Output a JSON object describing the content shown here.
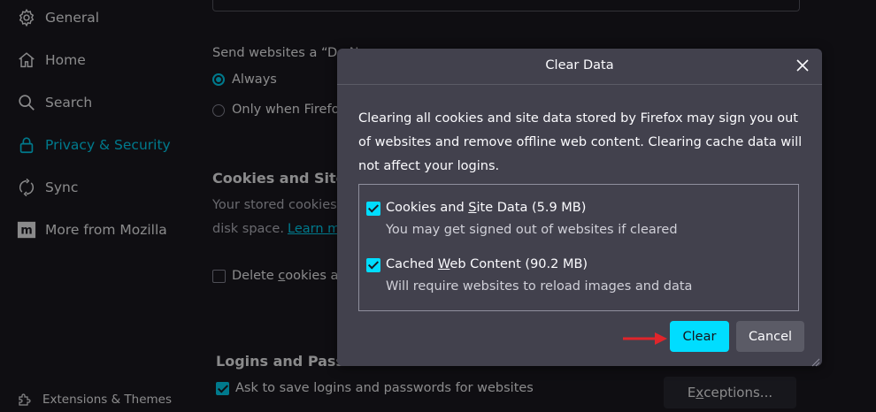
{
  "sidebar": {
    "items": [
      {
        "label": "General",
        "icon": "gear-icon"
      },
      {
        "label": "Home",
        "icon": "home-icon"
      },
      {
        "label": "Search",
        "icon": "search-icon"
      },
      {
        "label": "Privacy & Security",
        "icon": "lock-icon",
        "active": true
      },
      {
        "label": "Sync",
        "icon": "sync-icon"
      },
      {
        "label": "More from Mozilla",
        "icon": "mozilla-icon"
      }
    ],
    "extensions_label": "Extensions & Themes"
  },
  "main": {
    "dnt_text": "Send websites a “Do N",
    "radio_always": "Always",
    "radio_only_when": "Only when Firefox",
    "cookies_heading": "Cookies and Site D",
    "cookies_desc": "Your stored cookies, s",
    "disk_space": "disk space.",
    "learn_more": "Learn mo",
    "delete_cookies_pre": "Delete ",
    "delete_cookies_key": "c",
    "delete_cookies_post": "ookies and",
    "logins_heading": "Logins and Passw",
    "ask_save_logins": "Ask to save logins and passwords for websites",
    "exceptions_key": "x",
    "exceptions_pre": "E",
    "exceptions_post": "ceptions..."
  },
  "dialog": {
    "title": "Clear Data",
    "description": "Clearing all cookies and site data stored by Firefox may sign you out of websites and remove offline web content. Clearing cache data will not affect your logins.",
    "options": [
      {
        "label_pre": "Cookies and ",
        "label_key": "S",
        "label_post": "ite Data (5.9 MB)",
        "sub": "You may get signed out of websites if cleared",
        "checked": true
      },
      {
        "label_pre": "Cached ",
        "label_key": "W",
        "label_post": "eb Content (90.2 MB)",
        "sub": "Will require websites to reload images and data",
        "checked": true
      }
    ],
    "clear_button": "Clear",
    "cancel_button": "Cancel"
  },
  "colors": {
    "accent": "#00ddff",
    "background": "#1c1b22",
    "dialog_bg": "#42414d",
    "annotation_arrow": "#e0252b"
  }
}
